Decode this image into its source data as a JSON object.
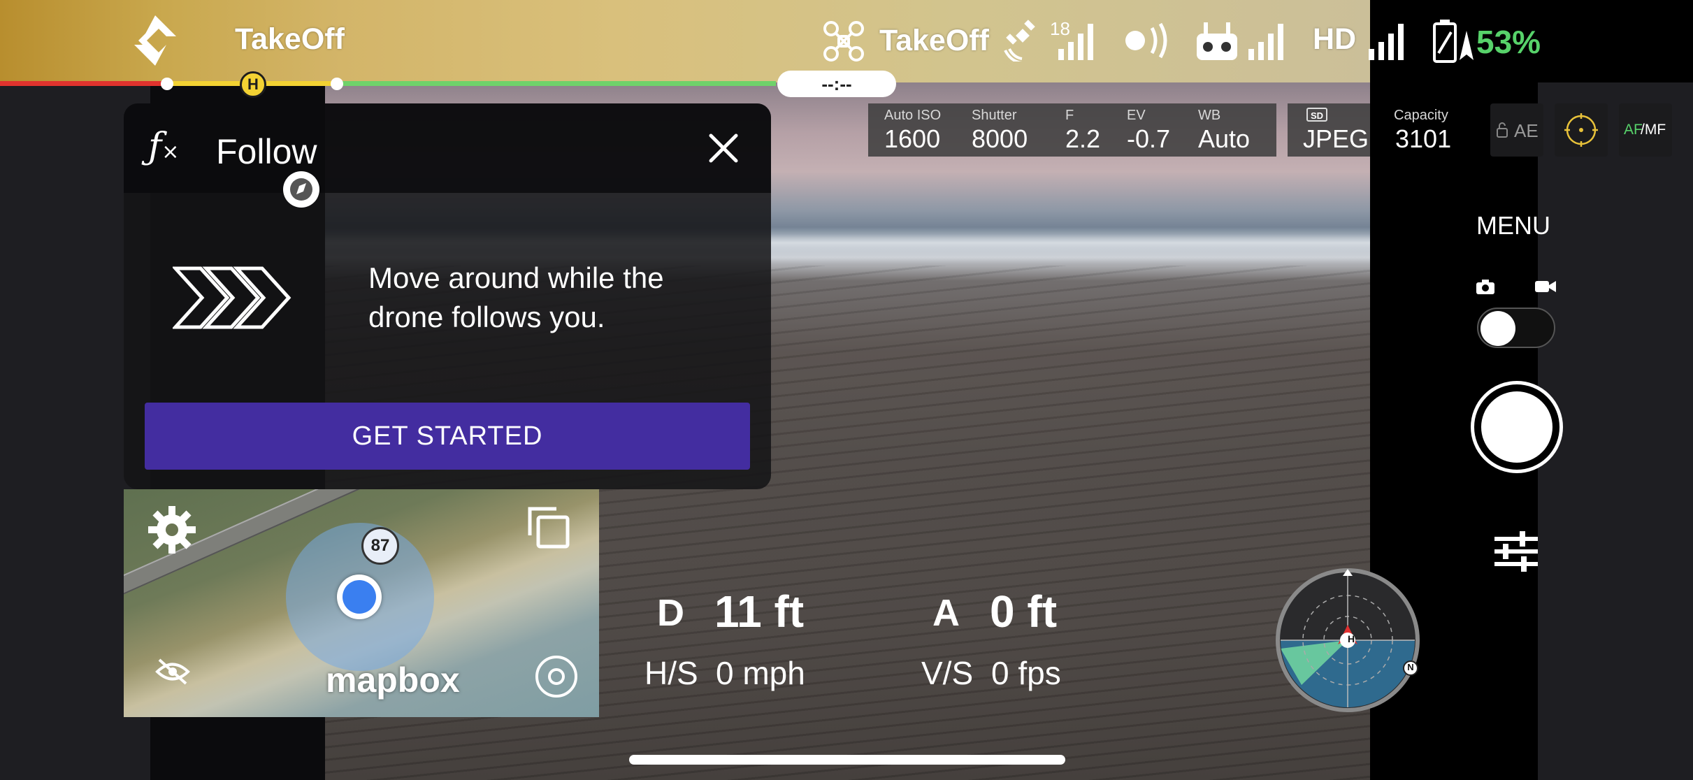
{
  "app": {
    "name": "TakeOff",
    "drone_name": "TakeOff",
    "gps_satellites": "18",
    "video_quality": "HD",
    "battery_percent": "53%",
    "timer": "--:--",
    "home_marker": "H",
    "accent_color": "#432da0",
    "battery_color": "#57d26a"
  },
  "camera_settings": {
    "iso_label": "Auto ISO",
    "iso_value": "1600",
    "shutter_label": "Shutter",
    "shutter_value": "8000",
    "f_label": "F",
    "f_value": "2.2",
    "ev_label": "EV",
    "ev_value": "-0.7",
    "wb_label": "WB",
    "wb_value": "Auto",
    "storage_badge": "SD",
    "format_value": "JPEG",
    "capacity_label": "Capacity",
    "capacity_value": "3101",
    "ae_label": "AE",
    "af_label": "AF",
    "mf_label": "/MF"
  },
  "right_panel": {
    "menu_label": "MENU",
    "photo_icon": "camera-icon",
    "video_icon": "video-icon",
    "settings_icon": "sliders-icon"
  },
  "follow_dialog": {
    "title": "Follow",
    "description": "Move around while the drone follows you.",
    "button_label": "GET STARTED",
    "icon": "fx-icon"
  },
  "map": {
    "badge_number": "87",
    "watermark": "mapbox",
    "settings_icon": "gear-icon",
    "expand_icon": "copy-icon",
    "hide_icon": "eye-off-icon",
    "info_icon": "info-icon"
  },
  "telemetry": {
    "distance_label": "D",
    "distance_value": "11 ft",
    "altitude_label": "A",
    "altitude_value": "0 ft",
    "hspeed_label": "H/S",
    "hspeed_value": "0 mph",
    "vspeed_label": "V/S",
    "vspeed_value": "0 fps"
  },
  "compass": {
    "north_label": "N",
    "home_label": "H"
  }
}
